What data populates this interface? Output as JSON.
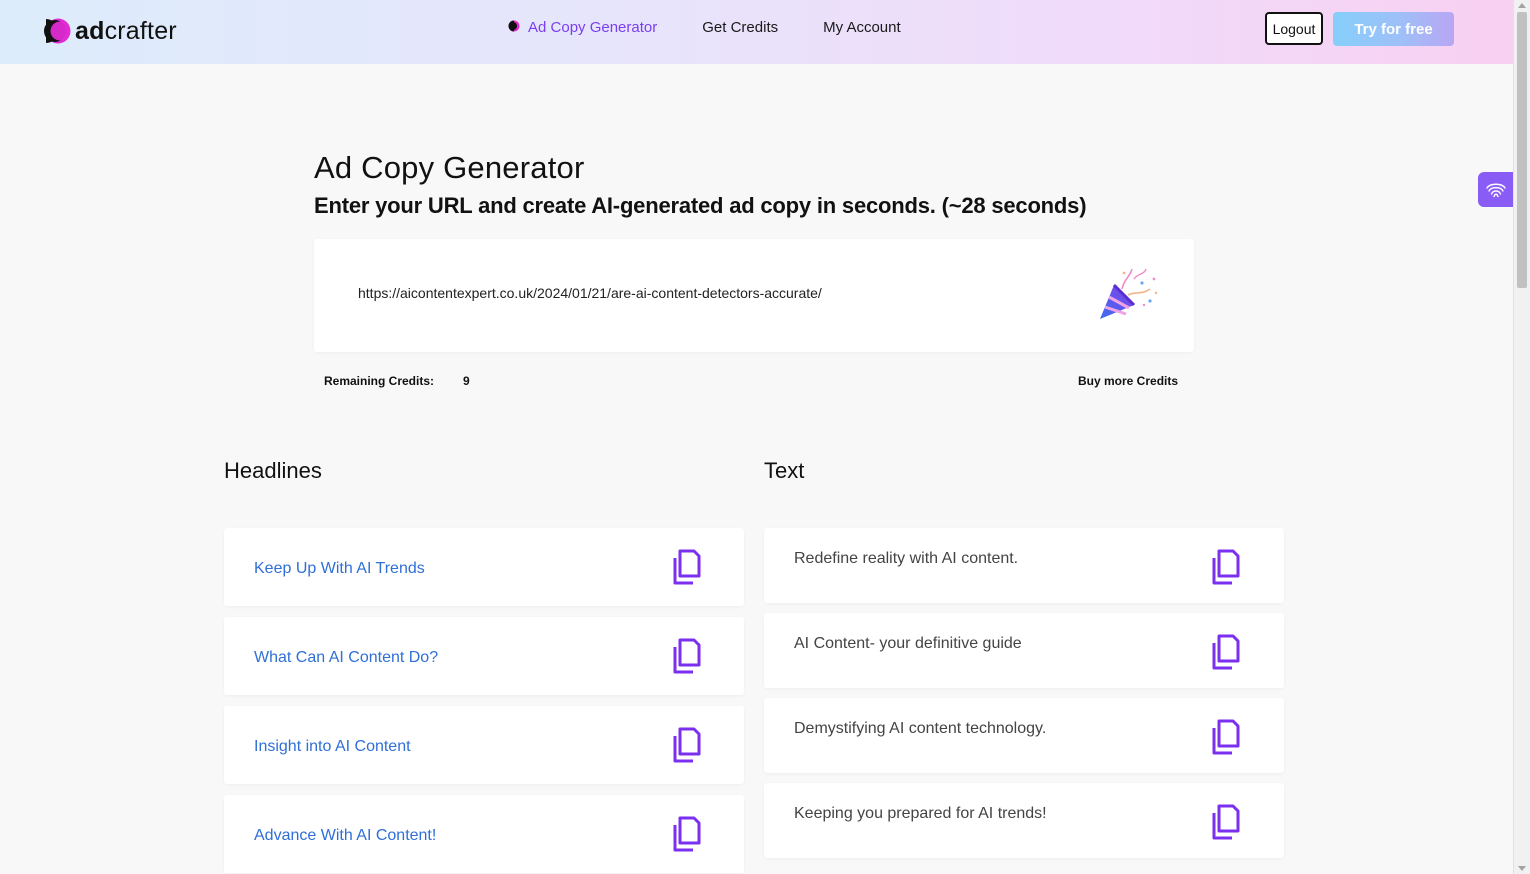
{
  "header": {
    "logo": {
      "prefix": "ad",
      "suffix": "crafter"
    },
    "nav": [
      {
        "label": "Ad Copy Generator",
        "active": true
      },
      {
        "label": "Get Credits",
        "active": false
      },
      {
        "label": "My Account",
        "active": false
      }
    ],
    "logout_label": "Logout",
    "try_label": "Try for free"
  },
  "main": {
    "title": "Ad Copy Generator",
    "subtitle": "Enter your URL and create AI-generated ad copy in seconds. (~28 seconds)",
    "url_value": "https://aicontentexpert.co.uk/2024/01/21/are-ai-content-detectors-accurate/",
    "credits_label": "Remaining Credits:",
    "credits_value": "9",
    "buy_label": "Buy more Credits"
  },
  "results": {
    "headlines_title": "Headlines",
    "text_title": "Text",
    "headlines": [
      "Keep Up With AI Trends",
      "What Can AI Content Do?",
      "Insight into AI Content",
      "Advance With AI Content!"
    ],
    "texts": [
      "Redefine reality with AI content.",
      "AI Content- your definitive guide",
      "Demystifying AI content technology.",
      "Keeping you prepared for AI trends!"
    ]
  },
  "colors": {
    "accent": "#7a3ef0",
    "headline_link": "#2f6fd6",
    "copy_icon": "#7b2ff0",
    "widget": "#8a5cf6"
  },
  "icons": {
    "copy": "copy-icon",
    "party": "party-popper-icon",
    "widget": "fingerprint-icon"
  }
}
